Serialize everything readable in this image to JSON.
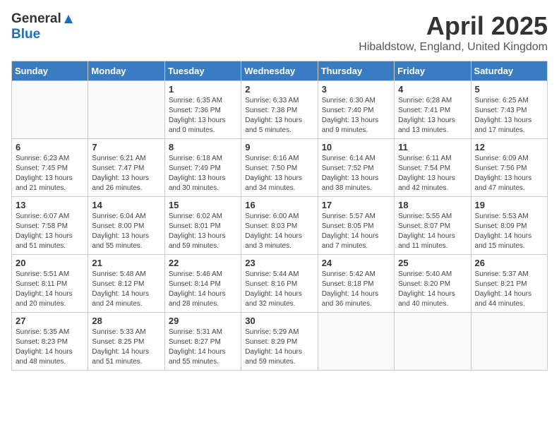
{
  "logo": {
    "general": "General",
    "blue": "Blue"
  },
  "title": "April 2025",
  "subtitle": "Hibaldstow, England, United Kingdom",
  "days_of_week": [
    "Sunday",
    "Monday",
    "Tuesday",
    "Wednesday",
    "Thursday",
    "Friday",
    "Saturday"
  ],
  "weeks": [
    [
      {
        "day": "",
        "info": ""
      },
      {
        "day": "",
        "info": ""
      },
      {
        "day": "1",
        "info": "Sunrise: 6:35 AM\nSunset: 7:36 PM\nDaylight: 13 hours and 0 minutes."
      },
      {
        "day": "2",
        "info": "Sunrise: 6:33 AM\nSunset: 7:38 PM\nDaylight: 13 hours and 5 minutes."
      },
      {
        "day": "3",
        "info": "Sunrise: 6:30 AM\nSunset: 7:40 PM\nDaylight: 13 hours and 9 minutes."
      },
      {
        "day": "4",
        "info": "Sunrise: 6:28 AM\nSunset: 7:41 PM\nDaylight: 13 hours and 13 minutes."
      },
      {
        "day": "5",
        "info": "Sunrise: 6:25 AM\nSunset: 7:43 PM\nDaylight: 13 hours and 17 minutes."
      }
    ],
    [
      {
        "day": "6",
        "info": "Sunrise: 6:23 AM\nSunset: 7:45 PM\nDaylight: 13 hours and 21 minutes."
      },
      {
        "day": "7",
        "info": "Sunrise: 6:21 AM\nSunset: 7:47 PM\nDaylight: 13 hours and 26 minutes."
      },
      {
        "day": "8",
        "info": "Sunrise: 6:18 AM\nSunset: 7:49 PM\nDaylight: 13 hours and 30 minutes."
      },
      {
        "day": "9",
        "info": "Sunrise: 6:16 AM\nSunset: 7:50 PM\nDaylight: 13 hours and 34 minutes."
      },
      {
        "day": "10",
        "info": "Sunrise: 6:14 AM\nSunset: 7:52 PM\nDaylight: 13 hours and 38 minutes."
      },
      {
        "day": "11",
        "info": "Sunrise: 6:11 AM\nSunset: 7:54 PM\nDaylight: 13 hours and 42 minutes."
      },
      {
        "day": "12",
        "info": "Sunrise: 6:09 AM\nSunset: 7:56 PM\nDaylight: 13 hours and 47 minutes."
      }
    ],
    [
      {
        "day": "13",
        "info": "Sunrise: 6:07 AM\nSunset: 7:58 PM\nDaylight: 13 hours and 51 minutes."
      },
      {
        "day": "14",
        "info": "Sunrise: 6:04 AM\nSunset: 8:00 PM\nDaylight: 13 hours and 55 minutes."
      },
      {
        "day": "15",
        "info": "Sunrise: 6:02 AM\nSunset: 8:01 PM\nDaylight: 13 hours and 59 minutes."
      },
      {
        "day": "16",
        "info": "Sunrise: 6:00 AM\nSunset: 8:03 PM\nDaylight: 14 hours and 3 minutes."
      },
      {
        "day": "17",
        "info": "Sunrise: 5:57 AM\nSunset: 8:05 PM\nDaylight: 14 hours and 7 minutes."
      },
      {
        "day": "18",
        "info": "Sunrise: 5:55 AM\nSunset: 8:07 PM\nDaylight: 14 hours and 11 minutes."
      },
      {
        "day": "19",
        "info": "Sunrise: 5:53 AM\nSunset: 8:09 PM\nDaylight: 14 hours and 15 minutes."
      }
    ],
    [
      {
        "day": "20",
        "info": "Sunrise: 5:51 AM\nSunset: 8:11 PM\nDaylight: 14 hours and 20 minutes."
      },
      {
        "day": "21",
        "info": "Sunrise: 5:48 AM\nSunset: 8:12 PM\nDaylight: 14 hours and 24 minutes."
      },
      {
        "day": "22",
        "info": "Sunrise: 5:46 AM\nSunset: 8:14 PM\nDaylight: 14 hours and 28 minutes."
      },
      {
        "day": "23",
        "info": "Sunrise: 5:44 AM\nSunset: 8:16 PM\nDaylight: 14 hours and 32 minutes."
      },
      {
        "day": "24",
        "info": "Sunrise: 5:42 AM\nSunset: 8:18 PM\nDaylight: 14 hours and 36 minutes."
      },
      {
        "day": "25",
        "info": "Sunrise: 5:40 AM\nSunset: 8:20 PM\nDaylight: 14 hours and 40 minutes."
      },
      {
        "day": "26",
        "info": "Sunrise: 5:37 AM\nSunset: 8:21 PM\nDaylight: 14 hours and 44 minutes."
      }
    ],
    [
      {
        "day": "27",
        "info": "Sunrise: 5:35 AM\nSunset: 8:23 PM\nDaylight: 14 hours and 48 minutes."
      },
      {
        "day": "28",
        "info": "Sunrise: 5:33 AM\nSunset: 8:25 PM\nDaylight: 14 hours and 51 minutes."
      },
      {
        "day": "29",
        "info": "Sunrise: 5:31 AM\nSunset: 8:27 PM\nDaylight: 14 hours and 55 minutes."
      },
      {
        "day": "30",
        "info": "Sunrise: 5:29 AM\nSunset: 8:29 PM\nDaylight: 14 hours and 59 minutes."
      },
      {
        "day": "",
        "info": ""
      },
      {
        "day": "",
        "info": ""
      },
      {
        "day": "",
        "info": ""
      }
    ]
  ]
}
